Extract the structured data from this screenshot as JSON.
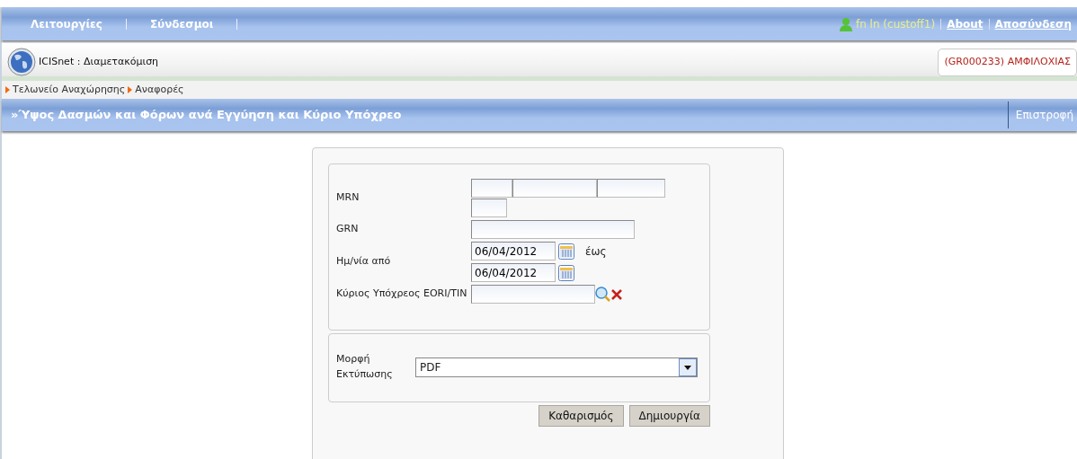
{
  "top_menu": {
    "items": [
      {
        "label": "Λειτουργίες"
      },
      {
        "label": "Σύνδεσμοι"
      }
    ],
    "user": "fn ln (custoff1)",
    "links": [
      {
        "label": "About"
      },
      {
        "label": "Αποσύνδεση"
      }
    ]
  },
  "header": {
    "app_title": "ICISnet : Διαμετακόμιση",
    "office": "(GR000233) ΑΜΦΙΛΟΧΙΑΣ"
  },
  "breadcrumb": [
    {
      "label": "Τελωνείο Αναχώρησης"
    },
    {
      "label": "Αναφορές"
    }
  ],
  "title_bar": {
    "prefix": "»",
    "title": "Ύψος Δασμών και Φόρων ανά Εγγύηση και Κύριο Υπόχρεο",
    "back": "Επιστροφή"
  },
  "form": {
    "mrn_label": "MRN",
    "grn_label": "GRN",
    "date_label": "Ημ/νία από",
    "date_from": "06/04/2012",
    "date_to_label": "έως",
    "date_to": "06/04/2012",
    "obligor_label": "Κύριος Υπόχρεος EORI/TIN",
    "format_label": "Μορφή Εκτύπωσης",
    "format_value": "PDF"
  },
  "buttons": [
    {
      "label": "Καθαρισμός"
    },
    {
      "label": "Δημιουργία"
    }
  ]
}
